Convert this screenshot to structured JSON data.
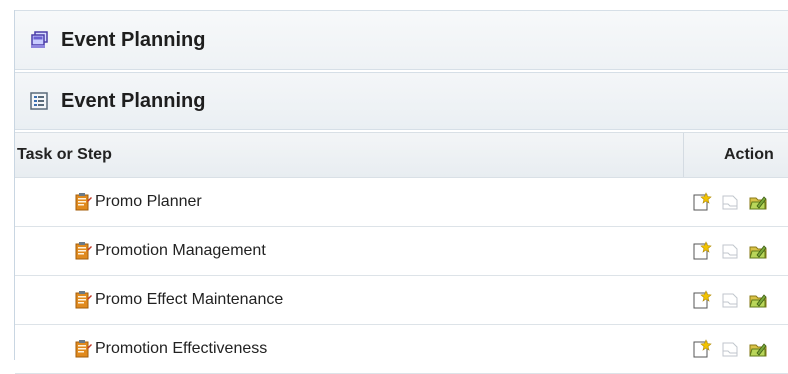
{
  "region": {
    "title": "Event Planning",
    "icon": "window-stack-icon"
  },
  "subregion": {
    "title": "Event Planning",
    "icon": "task-list-icon"
  },
  "table": {
    "columns": {
      "task": "Task or Step",
      "action": "Action"
    },
    "rows": [
      {
        "label": "Promo Planner"
      },
      {
        "label": "Promotion Management"
      },
      {
        "label": "Promo Effect Maintenance"
      },
      {
        "label": "Promotion Effectiveness"
      }
    ],
    "row_actions": [
      "create-icon",
      "view-icon",
      "edit-icon"
    ]
  }
}
